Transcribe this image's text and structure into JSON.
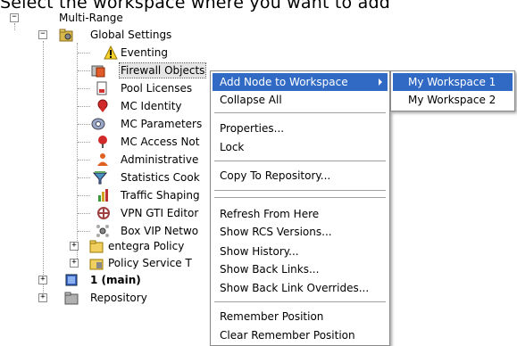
{
  "caption": "Select the workspace where you want to add",
  "tree": {
    "root": "Multi-Range",
    "global_settings": "Global Settings",
    "items": [
      "Eventing",
      "Firewall Objects",
      "Pool Licenses",
      "MC Identity",
      "MC Parameters",
      "MC Access Not",
      "Administrative",
      "Statistics Cook",
      "Traffic Shaping",
      "VPN GTI Editor",
      "Box VIP Netwo",
      "entegra Policy",
      "Policy Service T"
    ],
    "main": "1 (main)",
    "repository": "Repository"
  },
  "context_menu": {
    "items": [
      "Add Node to Workspace",
      "Collapse All",
      "Properties...",
      "Lock",
      "Copy To Repository...",
      "Refresh From Here",
      "Show RCS Versions...",
      "Show History...",
      "Show Back Links...",
      "Show Back Link Overrides...",
      "Remember Position",
      "Clear Remember Position"
    ]
  },
  "submenu": {
    "items": [
      "My Workspace 1",
      "My Workspace 2"
    ]
  },
  "colors": {
    "highlight": "#316ac5",
    "tree_line": "#9a9a9a"
  }
}
